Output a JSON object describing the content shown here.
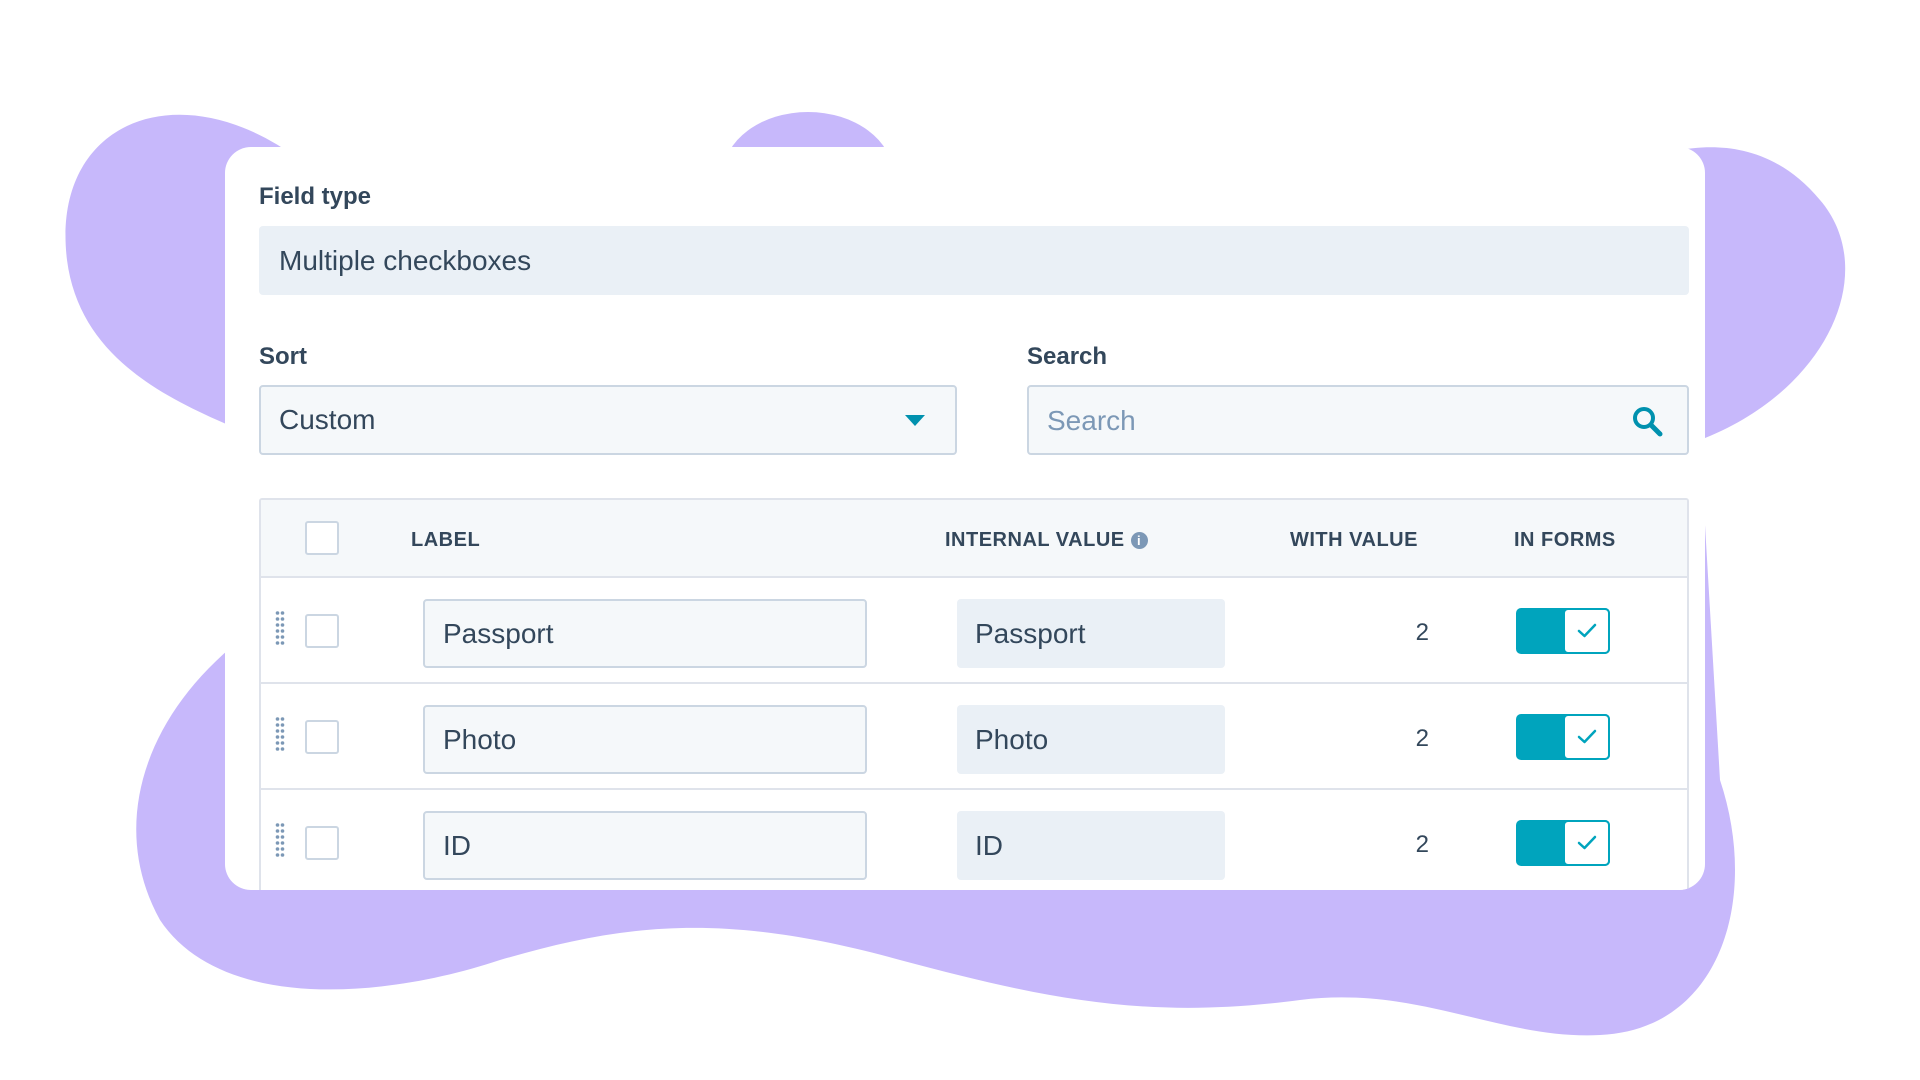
{
  "colors": {
    "blob": "#c7b8fb",
    "accent": "#00a4bd",
    "text": "#33475b",
    "placeholder": "#7c98b6",
    "border": "#cbd6e2",
    "field_bg": "#eaf0f6"
  },
  "field_type": {
    "label": "Field type",
    "value": "Multiple checkboxes"
  },
  "sort": {
    "label": "Sort",
    "value": "Custom",
    "icon": "caret-down-icon"
  },
  "search": {
    "label": "Search",
    "placeholder": "Search",
    "value": "",
    "icon": "search-icon"
  },
  "table": {
    "headers": {
      "label": "LABEL",
      "internal_value": "INTERNAL VALUE",
      "info_glyph": "i",
      "with_value": "WITH VALUE",
      "in_forms": "IN FORMS"
    },
    "rows": [
      {
        "label": "Passport",
        "internal_value": "Passport",
        "with_value": "2",
        "in_forms": true,
        "selected": false
      },
      {
        "label": "Photo",
        "internal_value": "Photo",
        "with_value": "2",
        "in_forms": true,
        "selected": false
      },
      {
        "label": "ID",
        "internal_value": "ID",
        "with_value": "2",
        "in_forms": true,
        "selected": false
      }
    ]
  }
}
